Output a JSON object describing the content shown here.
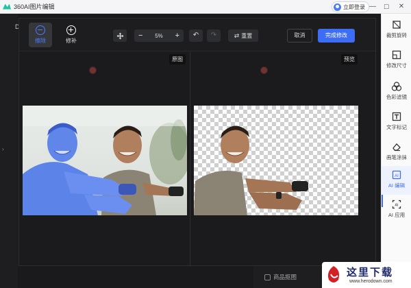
{
  "window": {
    "title": "360AI图片编辑",
    "login_label": "立即登录",
    "minimize": "—",
    "maximize": "☐",
    "close": "✕"
  },
  "toolbar": {
    "erase_label": "擦除",
    "repair_label": "修补",
    "zoom_value": "5%",
    "reset_label": "重置",
    "cancel_label": "取消",
    "finish_label": "完成修改"
  },
  "panes": {
    "original_label": "原图",
    "preview_label": "预览"
  },
  "right_panel": {
    "items": [
      {
        "label": "裁剪旋转",
        "icon": "crop-icon"
      },
      {
        "label": "修改尺寸",
        "icon": "resize-icon"
      },
      {
        "label": "色彩滤镜",
        "icon": "color-filter-icon"
      },
      {
        "label": "文字标记",
        "icon": "text-icon"
      },
      {
        "label": "画笔涂抹",
        "icon": "eraser-icon"
      },
      {
        "label": "AI 编辑",
        "icon": "ai-edit-icon",
        "active": true
      },
      {
        "label": "AI 应用",
        "icon": "ai-app-icon"
      }
    ]
  },
  "background": {
    "product_cutout_label": "商品抠图",
    "left_letter": "D"
  },
  "watermark": {
    "brand": "这里下载",
    "url": "www.herodown.com"
  },
  "colors": {
    "accent": "#3e6df5",
    "modal_bg": "#1d1d1f"
  }
}
